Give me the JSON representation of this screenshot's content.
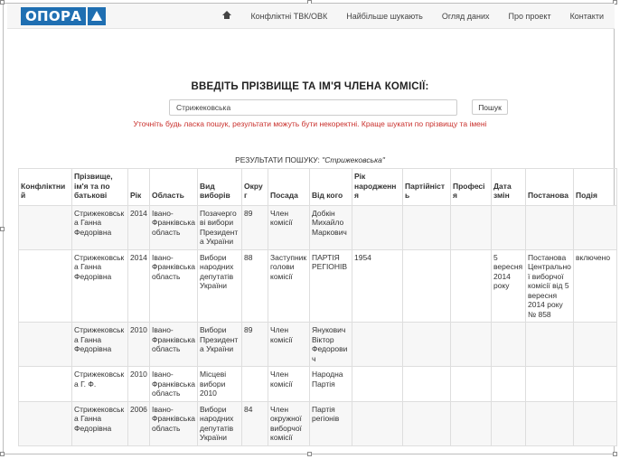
{
  "logo": {
    "text": "ОПОРА"
  },
  "nav": {
    "items": [
      {
        "label": "Конфліктні ТВК/ОВК"
      },
      {
        "label": "Найбільше шукають"
      },
      {
        "label": "Огляд даних"
      },
      {
        "label": "Про проект"
      },
      {
        "label": "Контакти"
      }
    ]
  },
  "search": {
    "heading": "ВВЕДІТЬ ПРІЗВИЩЕ ТА ІМ'Я ЧЛЕНА КОМІСІЇ:",
    "value": "Стрижековська",
    "button_label": "Пошук",
    "warning": "Уточніть будь ласка пошук, результати можуть бути некоректні. Краще шукати по прізвищу та імені"
  },
  "results": {
    "caption_prefix": "РЕЗУЛЬТАТИ ПОШУКУ: ",
    "caption_query": "\"Стрижековська\"",
    "columns": [
      "Конфліктний",
      "Прізвище, ім'я та по батькові",
      "Рік",
      "Область",
      "Вид виборів",
      "Округ",
      "Посада",
      "Від кого",
      "Рік народження",
      "Партійність",
      "Професія",
      "Дата змін",
      "Постанова",
      "Подія"
    ],
    "rows": [
      [
        "",
        "Стрижековська Ганна Федорівна",
        "2014",
        "Івано-Франківська область",
        "Позачергові вибори Президента України",
        "89",
        "Член комісії",
        "Добкін Михайло Маркович",
        "",
        "",
        "",
        "",
        "",
        ""
      ],
      [
        "",
        "Стрижековська Ганна Федорівна",
        "2014",
        "Івано-Франківська область",
        "Вибори народних депутатів України",
        "88",
        "Заступник голови комісії",
        "ПАРТІЯ РЕГІОНІВ",
        "1954",
        "",
        "",
        "5 вересня 2014 року",
        "Постанова Центральної виборчої комісії від 5 вересня 2014 року № 858",
        "включено"
      ],
      [
        "",
        "Стрижековська Ганна Федорівна",
        "2010",
        "Івано-Франківська область",
        "Вибори Президента України",
        "89",
        "Член комісії",
        "Янукович Віктор Федорович",
        "",
        "",
        "",
        "",
        "",
        ""
      ],
      [
        "",
        "Стрижековська Г. Ф.",
        "2010",
        "Івано-Франківська область",
        "Місцеві вибори 2010",
        "",
        "Член комісії",
        "Народна Партія",
        "",
        "",
        "",
        "",
        "",
        ""
      ],
      [
        "",
        "Стрижековська Ганна Федорівна",
        "2006",
        "Івано-Франківська область",
        "Вибори народних депутатів України",
        "84",
        "Член окружної виборчої комісії",
        "Партія регіонів",
        "",
        "",
        "",
        "",
        "",
        ""
      ]
    ]
  }
}
